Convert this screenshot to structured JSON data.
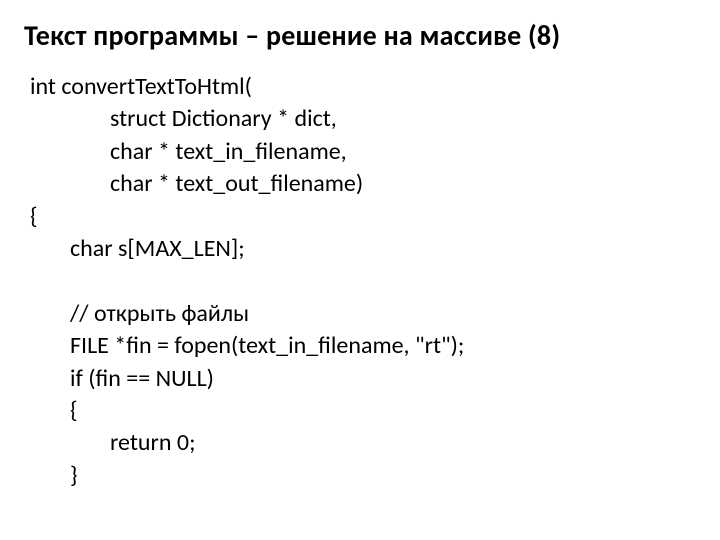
{
  "title": "Текст программы – решение на массиве (8)",
  "code": {
    "l1": "int convertTextToHtml(",
    "l2": "struct Dictionary * dict,",
    "l3": "char * text_in_filename,",
    "l4": "char * text_out_filename)",
    "l5": "{",
    "l6": "char s[MAX_LEN];",
    "blank": "",
    "l7": "// открыть файлы",
    "l8": "FILE *fin = fopen(text_in_filename, \"rt\");",
    "l9": "if (fin == NULL)",
    "l10": "{",
    "l11": "return 0;",
    "l12": "}"
  }
}
